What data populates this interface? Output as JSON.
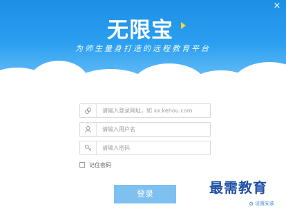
{
  "app": {
    "logo_text": "无限宝",
    "slogan": "为师生量身打造的远程教育平台",
    "close_label": "×"
  },
  "login": {
    "url_placeholder": "请输入登录网址，如 xx.kehou.com",
    "username_placeholder": "请输入用户名",
    "password_placeholder": "请输入密码",
    "remember_label": "记住密码",
    "submit_label": "登录"
  },
  "footer": {
    "watermark": "最需教育",
    "setup_label": "设置安装"
  },
  "icons": {
    "url": "link-icon",
    "user": "user-icon",
    "password": "key-icon",
    "settings": "gear-icon"
  },
  "colors": {
    "banner_top": "#1d8fe6",
    "button": "#7ec1f0",
    "watermark": "#1f4fa8"
  }
}
